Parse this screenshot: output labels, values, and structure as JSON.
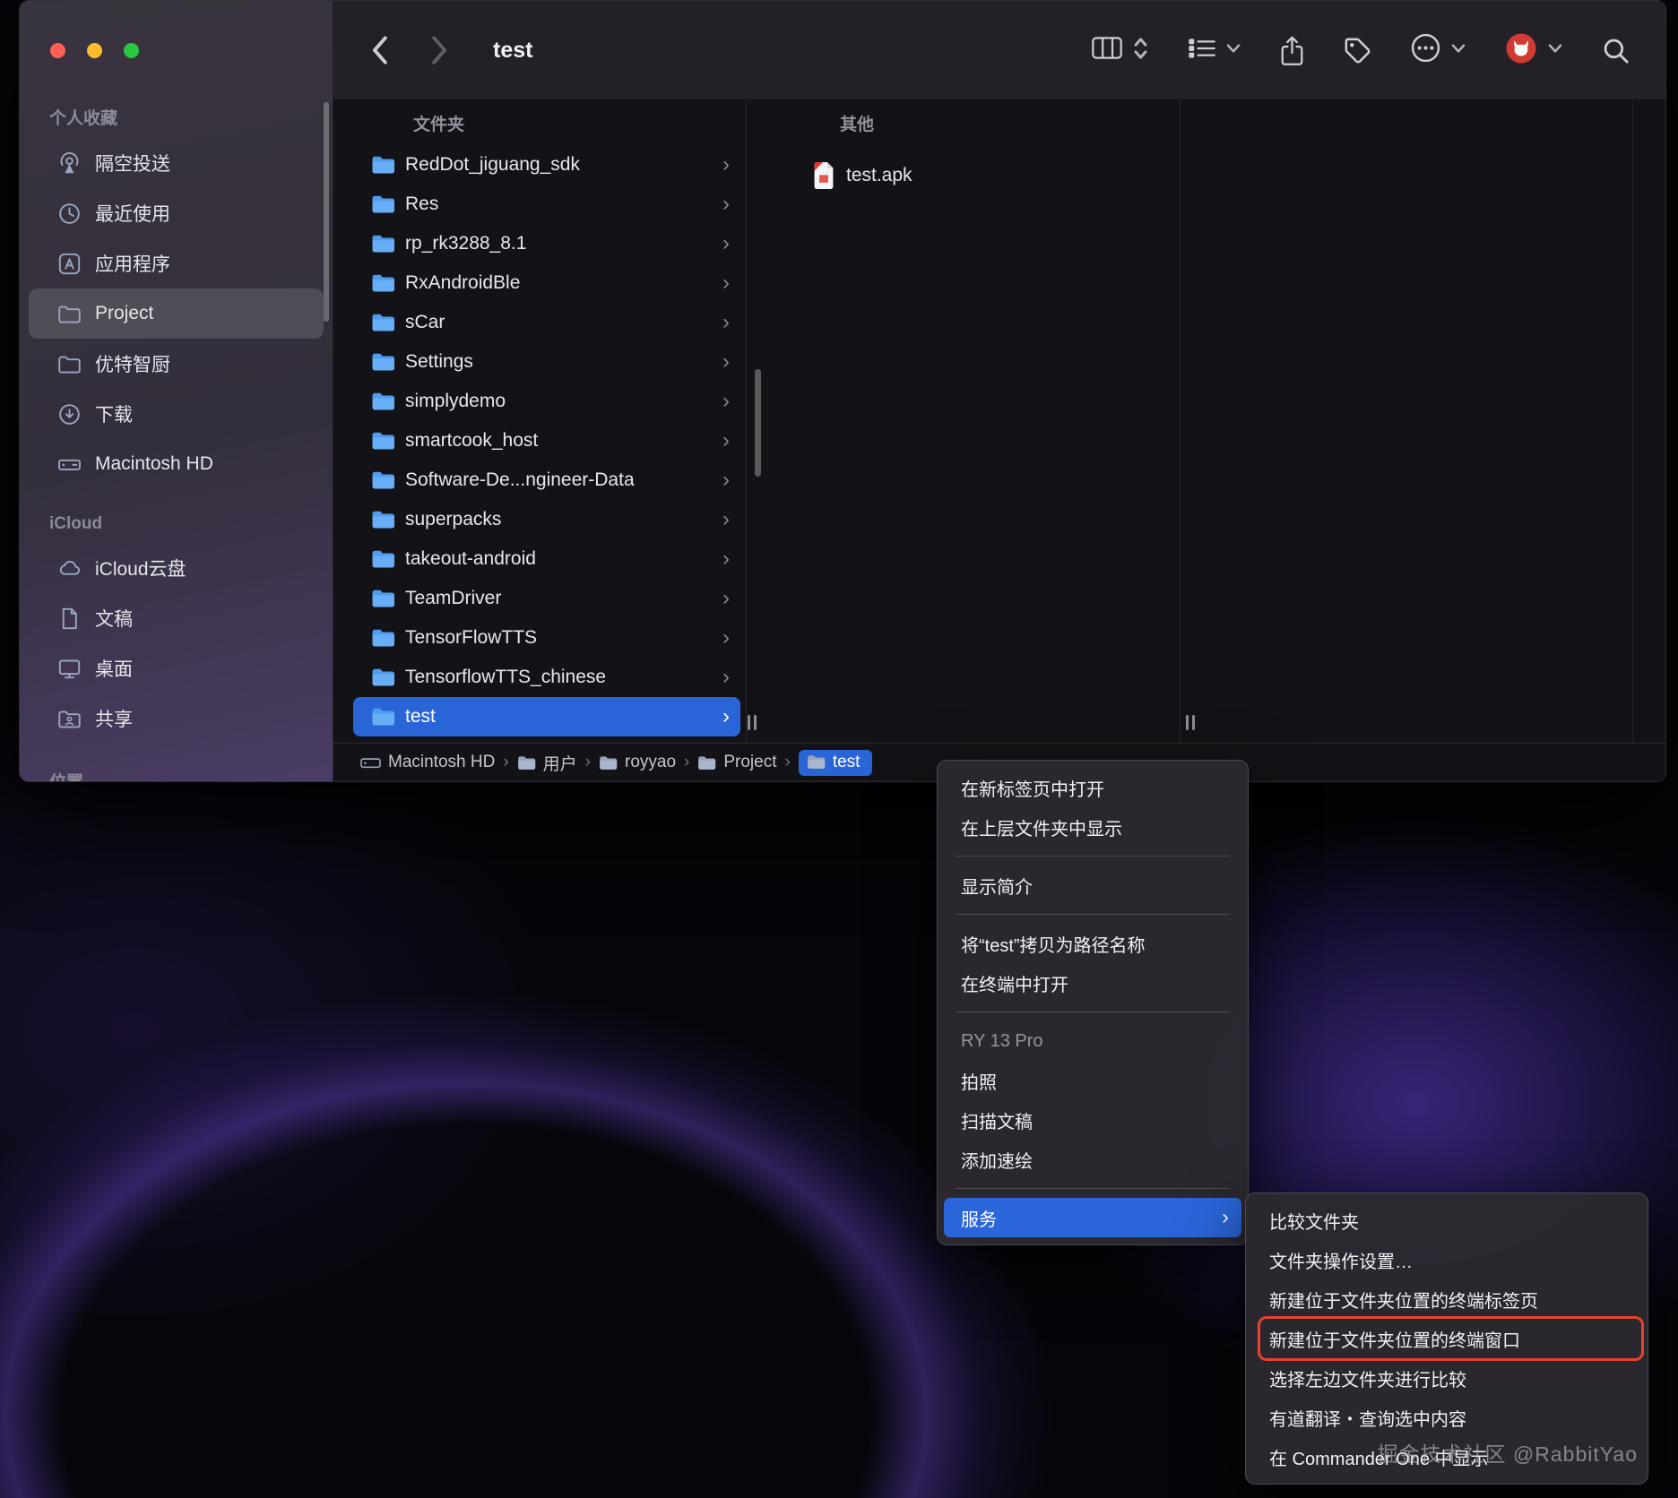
{
  "window": {
    "title": "test"
  },
  "sidebar": {
    "sections": [
      {
        "title": "个人收藏",
        "items": [
          {
            "name": "airdrop",
            "label": "隔空投送",
            "icon": "airdrop-icon"
          },
          {
            "name": "recents",
            "label": "最近使用",
            "icon": "clock-icon"
          },
          {
            "name": "applications",
            "label": "应用程序",
            "icon": "applications-icon"
          },
          {
            "name": "project",
            "label": "Project",
            "icon": "folder-outline-icon",
            "selected": true
          },
          {
            "name": "youtezhichu",
            "label": "优特智厨",
            "icon": "folder-outline-icon"
          },
          {
            "name": "downloads",
            "label": "下载",
            "icon": "download-icon"
          },
          {
            "name": "macintosh-hd",
            "label": "Macintosh HD",
            "icon": "harddrive-icon"
          }
        ]
      },
      {
        "title": "iCloud",
        "items": [
          {
            "name": "icloud-drive",
            "label": "iCloud云盘",
            "icon": "cloud-icon"
          },
          {
            "name": "documents",
            "label": "文稿",
            "icon": "document-icon"
          },
          {
            "name": "desktop",
            "label": "桌面",
            "icon": "desktop-icon"
          },
          {
            "name": "shared",
            "label": "共享",
            "icon": "shared-icon"
          }
        ]
      },
      {
        "title": "位置",
        "items": []
      }
    ]
  },
  "columns": {
    "folders": {
      "header": "文件夹",
      "selected": "test",
      "items": [
        "RedDot_jiguang_sdk",
        "Res",
        "rp_rk3288_8.1",
        "RxAndroidBle",
        "sCar",
        "Settings",
        "simplydemo",
        "smartcook_host",
        "Software-De...ngineer-Data",
        "superpacks",
        "takeout-android",
        "TeamDriver",
        "TensorFlowTTS",
        "TensorflowTTS_chinese",
        "test"
      ]
    },
    "other": {
      "header": "其他",
      "items": [
        {
          "label": "test.apk",
          "icon": "apk-file-icon"
        }
      ]
    }
  },
  "pathbar": {
    "items": [
      {
        "label": "Macintosh HD",
        "icon": "harddrive-small-icon"
      },
      {
        "label": "用户",
        "icon": "folder-small-icon"
      },
      {
        "label": "royyao",
        "icon": "folder-small-icon"
      },
      {
        "label": "Project",
        "icon": "folder-small-icon"
      },
      {
        "label": "test",
        "icon": "folder-small-icon",
        "selected": true
      }
    ]
  },
  "context_menu": {
    "items": [
      {
        "id": "open-new-tab",
        "label": "在新标签页中打开"
      },
      {
        "id": "show-enclosing-folder",
        "label": "在上层文件夹中显示"
      },
      {
        "divider": true
      },
      {
        "id": "get-info",
        "label": "显示简介"
      },
      {
        "divider": true
      },
      {
        "id": "copy-pathname",
        "label": "将“test”拷贝为路径名称"
      },
      {
        "id": "open-in-terminal",
        "label": "在终端中打开"
      },
      {
        "divider": true
      },
      {
        "id": "ry13pro-header",
        "label": "RY 13 Pro",
        "muted": true
      },
      {
        "id": "take-photo",
        "label": "拍照"
      },
      {
        "id": "scan-documents",
        "label": "扫描文稿"
      },
      {
        "id": "add-sketch",
        "label": "添加速绘"
      },
      {
        "divider": true
      },
      {
        "id": "services",
        "label": "服务",
        "highlighted": true,
        "submenu": true
      }
    ]
  },
  "submenu": {
    "items": [
      {
        "id": "compare-folders",
        "label": "比较文件夹"
      },
      {
        "id": "folder-actions-setup",
        "label": "文件夹操作设置…"
      },
      {
        "id": "new-terminal-tab-at-folder",
        "label": "新建位于文件夹位置的终端标签页"
      },
      {
        "id": "new-terminal-window-at-folder",
        "label": "新建位于文件夹位置的终端窗口",
        "annotated": true
      },
      {
        "id": "select-left-folder-compare",
        "label": "选择左边文件夹进行比较"
      },
      {
        "id": "youdao-translate",
        "label": "有道翻译・查询选中内容"
      },
      {
        "id": "show-in-commander-one",
        "label": "在 Commander One 中显示"
      }
    ]
  },
  "watermark": "掘金技术社区 @RabbitYao",
  "colors": {
    "selection_blue": "#2a65d8",
    "annotation_red": "#e8432d",
    "folder_blue": "#55a1f0"
  }
}
